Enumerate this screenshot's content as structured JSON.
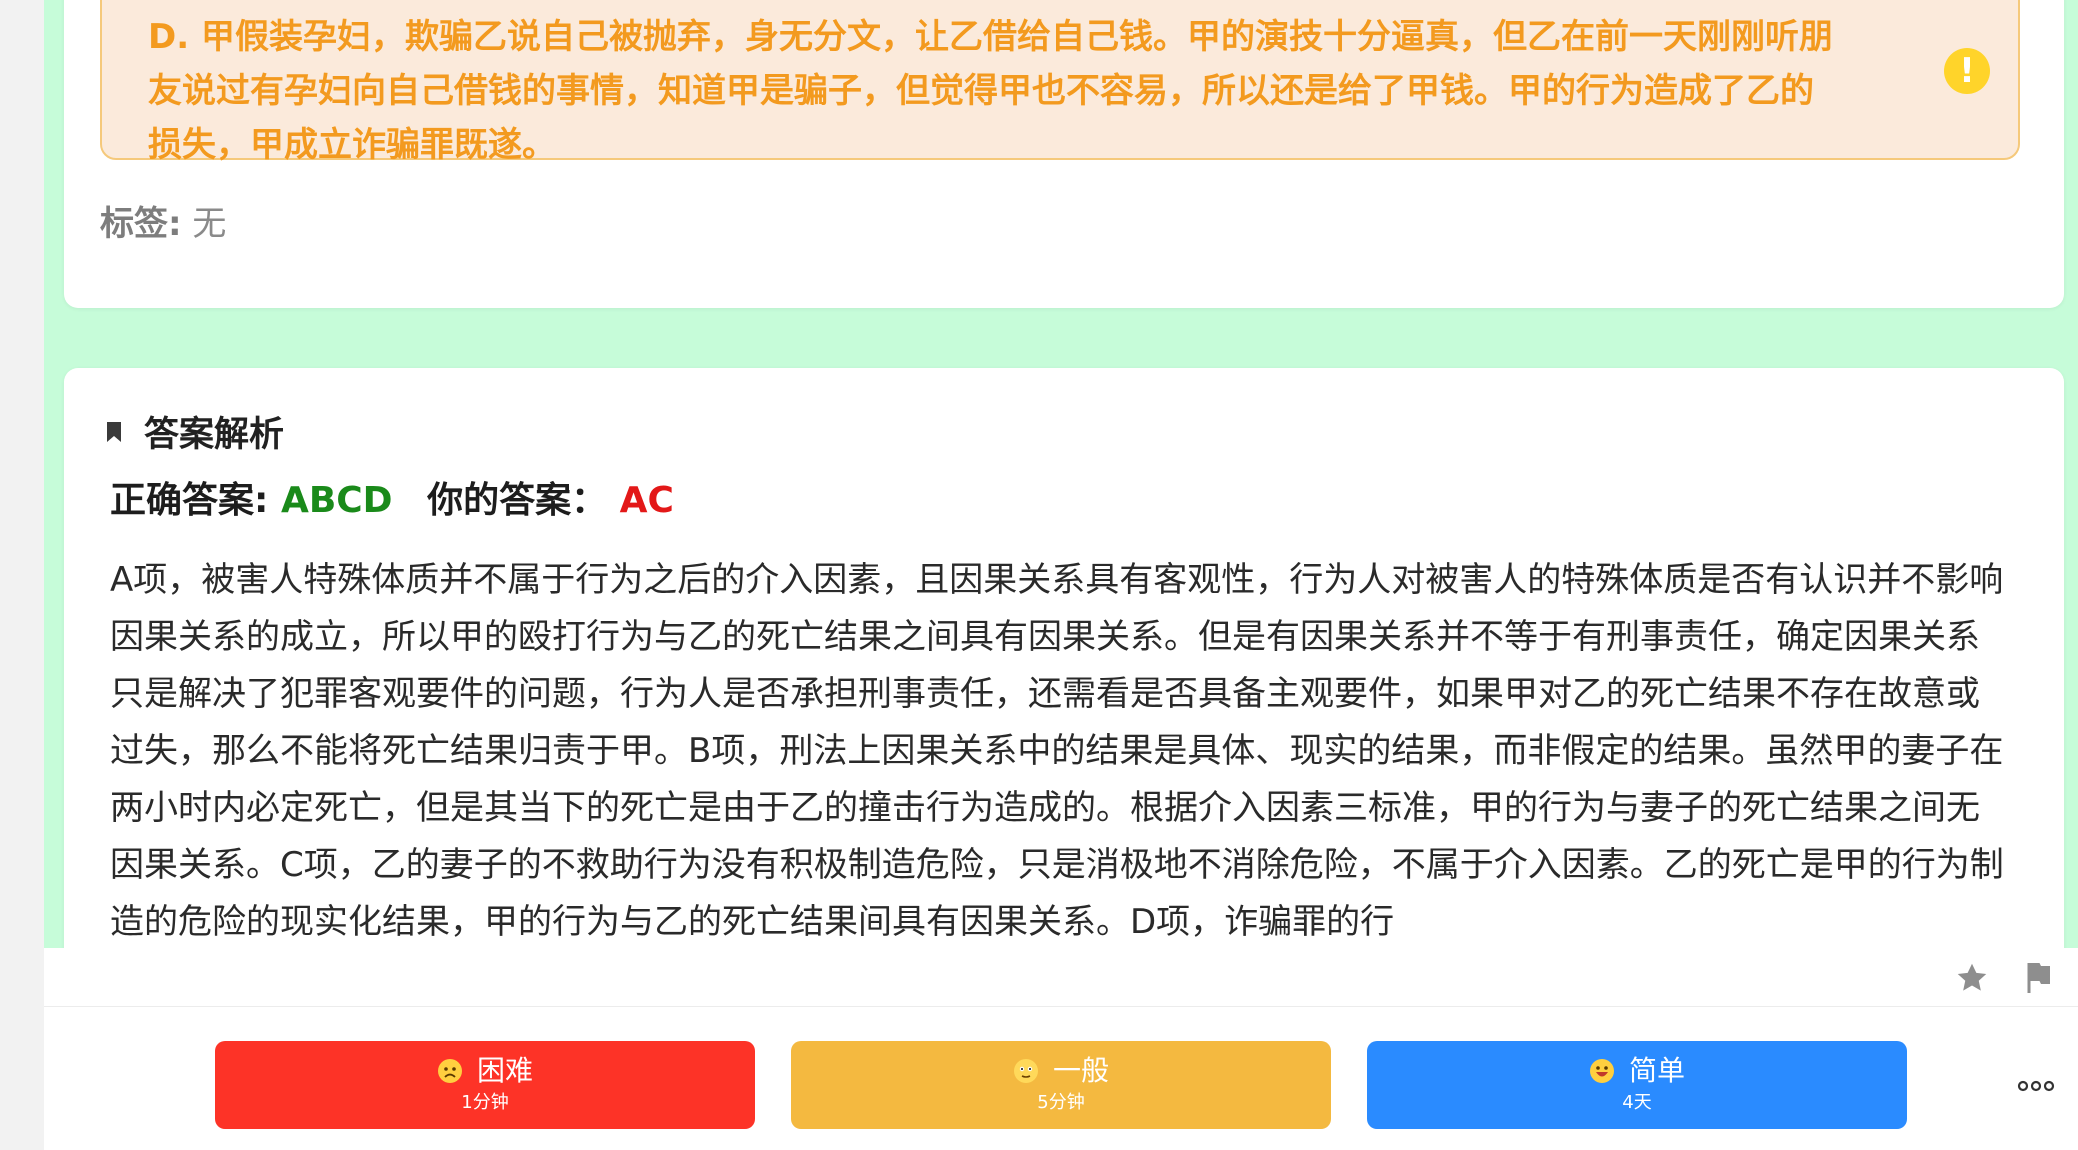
{
  "question": {
    "option_d_text": "D. 甲假装孕妇，欺骗乙说自己被抛弃，身无分文，让乙借给自己钱。甲的演技十分逼真，但乙在前一天刚刚听朋\n友说过有孕妇向自己借钱的事情，知道甲是骗子，但觉得甲也不容易，所以还是给了甲钱。甲的行为造成了乙的\n损失，甲成立诈骗罪既遂。",
    "warning_glyph": "!",
    "tags_label": "标签:",
    "tags_value": "无"
  },
  "analysis": {
    "title": "答案解析",
    "correct_label": "正确答案:",
    "correct_value": "ABCD",
    "mine_label": "你的答案：",
    "mine_value": "AC",
    "text": "A项，被害人特殊体质并不属于行为之后的介入因素，且因果关系具有客观性，行为人对被害人的特殊体质是否有认识并不影响因果关系的成立，所以甲的殴打行为与乙的死亡结果之间具有因果关系。但是有因果关系并不等于有刑事责任，确定因果关系只是解决了犯罪客观要件的问题，行为人是否承担刑事责任，还需看是否具备主观要件，如果甲对乙的死亡结果不存在故意或过失，那么不能将死亡结果归责于甲。B项，刑法上因果关系中的结果是具体、现实的结果，而非假定的结果。虽然甲的妻子在两小时内必定死亡，但是其当下的死亡是由于乙的撞击行为造成的。根据介入因素三标准，甲的行为与妻子的死亡结果之间无因果关系。C项，乙的妻子的不救助行为没有积极制造危险，只是消极地不消除危险，不属于介入因素。乙的死亡是甲的行为制造的危险的现实化结果，甲的行为与乙的死亡结果间具有因果关系。D项，诈骗罪的行"
  },
  "toolbar": {
    "star_icon": "star-icon",
    "flag_icon": "flag-icon"
  },
  "rating": {
    "hard": {
      "label": "困难",
      "interval": "1分钟",
      "color": "#fd3327"
    },
    "medium": {
      "label": "一般",
      "interval": "5分钟",
      "color": "#f4b940"
    },
    "easy": {
      "label": "简单",
      "interval": "4天",
      "color": "#2a8bff"
    },
    "more_icon": "more-icon"
  }
}
